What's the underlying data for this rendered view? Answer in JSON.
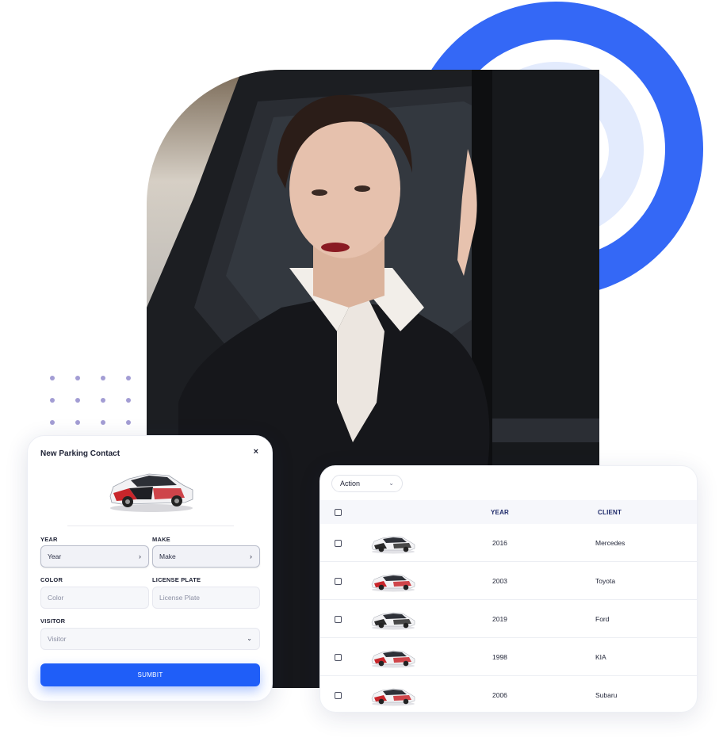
{
  "form": {
    "title": "New Parking Contact",
    "close_icon": "×",
    "fields": {
      "year": {
        "label": "YEAR",
        "value": "Year"
      },
      "make": {
        "label": "MAKE",
        "value": "Make"
      },
      "color": {
        "label": "COLOR",
        "placeholder": "Color"
      },
      "license_plate": {
        "label": "LICENSE PLATE",
        "placeholder": "License Plate"
      },
      "visitor": {
        "label": "VISITOR",
        "value": "Visitor"
      }
    },
    "submit_label": "SUMBIT"
  },
  "table": {
    "action_label": "Action",
    "columns": [
      "YEAR",
      "CLIENT"
    ],
    "rows": [
      {
        "year": "2016",
        "client": "Mercedes",
        "car_color": "#2a2a2a"
      },
      {
        "year": "2003",
        "client": "Toyota",
        "car_color": "#c8262b"
      },
      {
        "year": "2019",
        "client": "Ford",
        "car_color": "#2a2a2a"
      },
      {
        "year": "1998",
        "client": "KIA",
        "car_color": "#c8262b"
      },
      {
        "year": "2006",
        "client": "Subaru",
        "car_color": "#c8262b"
      }
    ]
  },
  "colors": {
    "accent": "#1f5ef8",
    "ring": "#3468f6",
    "ring_light": "#e3ebfd"
  }
}
